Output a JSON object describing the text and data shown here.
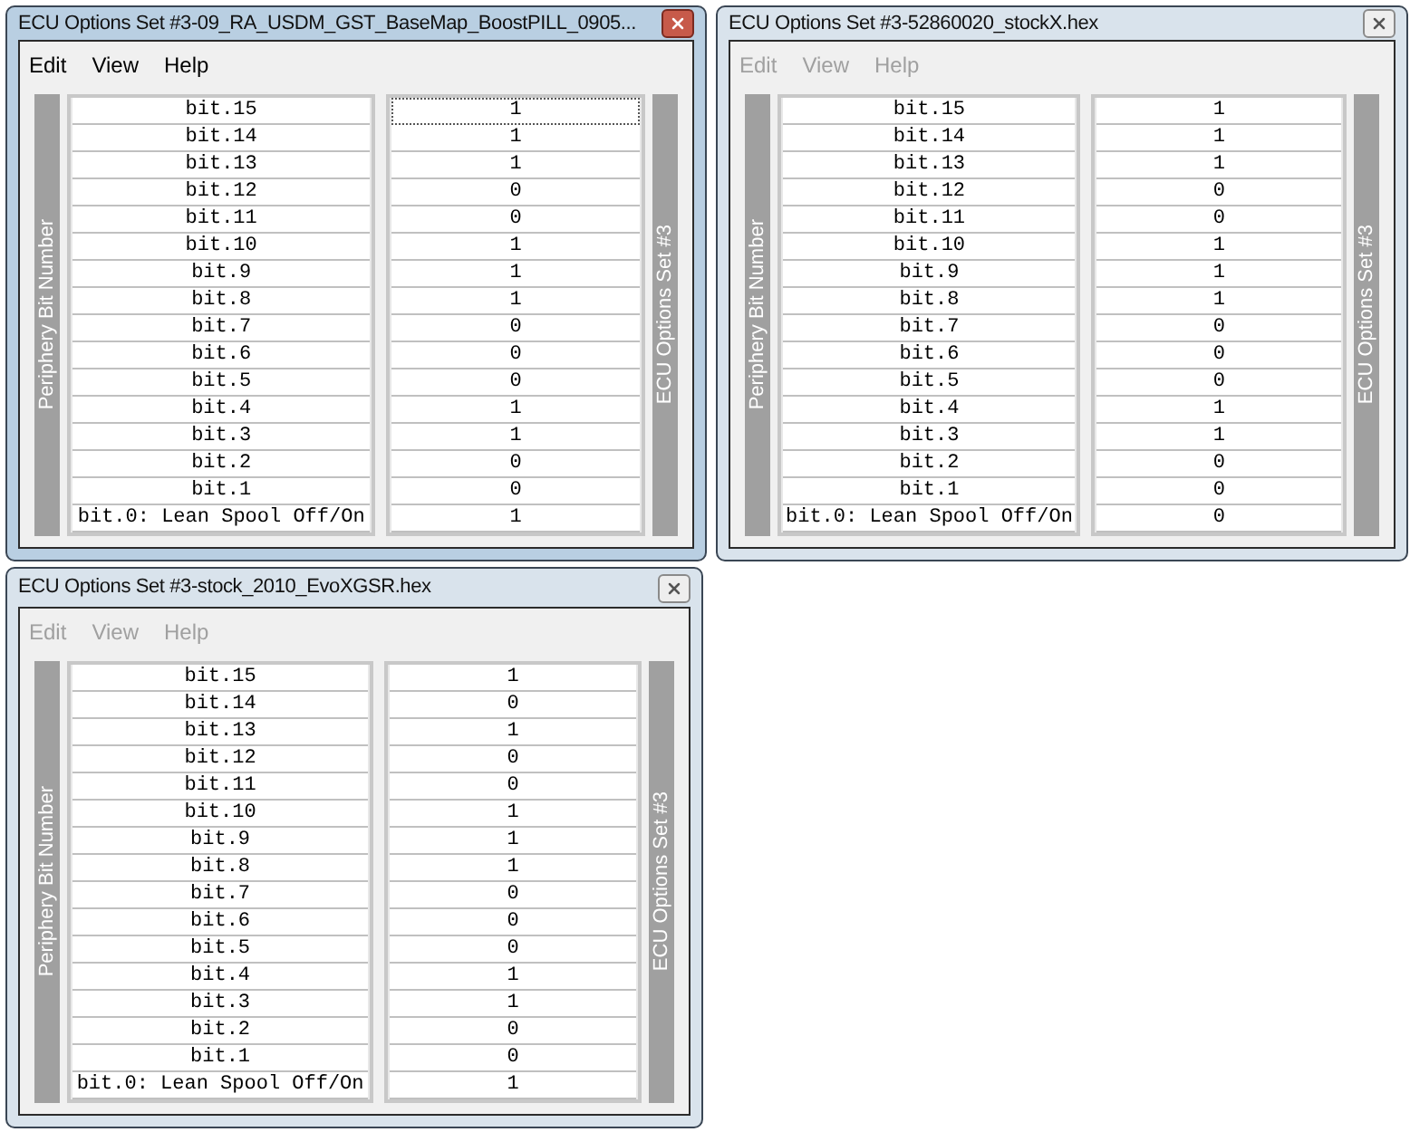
{
  "windows": [
    {
      "title": "ECU Options Set #3-09_RA_USDM_GST_BaseMap_BoostPILL_0905...",
      "active": true,
      "menu": [
        "Edit",
        "View",
        "Help"
      ],
      "left_axis": "Periphery Bit Number",
      "right_axis": "ECU Options Set #3",
      "rows": [
        {
          "label": "bit.15",
          "value": "1",
          "focused": true
        },
        {
          "label": "bit.14",
          "value": "1",
          "focused": false
        },
        {
          "label": "bit.13",
          "value": "1",
          "focused": false
        },
        {
          "label": "bit.12",
          "value": "0",
          "focused": false
        },
        {
          "label": "bit.11",
          "value": "0",
          "focused": false
        },
        {
          "label": "bit.10",
          "value": "1",
          "focused": false
        },
        {
          "label": "bit.9",
          "value": "1",
          "focused": false
        },
        {
          "label": "bit.8",
          "value": "1",
          "focused": false
        },
        {
          "label": "bit.7",
          "value": "0",
          "focused": false
        },
        {
          "label": "bit.6",
          "value": "0",
          "focused": false
        },
        {
          "label": "bit.5",
          "value": "0",
          "focused": false
        },
        {
          "label": "bit.4",
          "value": "1",
          "focused": false
        },
        {
          "label": "bit.3",
          "value": "1",
          "focused": false
        },
        {
          "label": "bit.2",
          "value": "0",
          "focused": false
        },
        {
          "label": "bit.1",
          "value": "0",
          "focused": false
        },
        {
          "label": "bit.0: Lean Spool Off/On",
          "value": "1",
          "focused": false
        }
      ]
    },
    {
      "title": "ECU Options Set #3-52860020_stockX.hex",
      "active": false,
      "menu": [
        "Edit",
        "View",
        "Help"
      ],
      "left_axis": "Periphery Bit Number",
      "right_axis": "ECU Options Set #3",
      "rows": [
        {
          "label": "bit.15",
          "value": "1",
          "focused": false
        },
        {
          "label": "bit.14",
          "value": "1",
          "focused": false
        },
        {
          "label": "bit.13",
          "value": "1",
          "focused": false
        },
        {
          "label": "bit.12",
          "value": "0",
          "focused": false
        },
        {
          "label": "bit.11",
          "value": "0",
          "focused": false
        },
        {
          "label": "bit.10",
          "value": "1",
          "focused": false
        },
        {
          "label": "bit.9",
          "value": "1",
          "focused": false
        },
        {
          "label": "bit.8",
          "value": "1",
          "focused": false
        },
        {
          "label": "bit.7",
          "value": "0",
          "focused": false
        },
        {
          "label": "bit.6",
          "value": "0",
          "focused": false
        },
        {
          "label": "bit.5",
          "value": "0",
          "focused": false
        },
        {
          "label": "bit.4",
          "value": "1",
          "focused": false
        },
        {
          "label": "bit.3",
          "value": "1",
          "focused": false
        },
        {
          "label": "bit.2",
          "value": "0",
          "focused": false
        },
        {
          "label": "bit.1",
          "value": "0",
          "focused": false
        },
        {
          "label": "bit.0: Lean Spool Off/On",
          "value": "0",
          "focused": false
        }
      ]
    },
    {
      "title": "ECU Options Set #3-stock_2010_EvoXGSR.hex",
      "active": false,
      "menu": [
        "Edit",
        "View",
        "Help"
      ],
      "left_axis": "Periphery Bit Number",
      "right_axis": "ECU Options Set #3",
      "rows": [
        {
          "label": "bit.15",
          "value": "1",
          "focused": false
        },
        {
          "label": "bit.14",
          "value": "0",
          "focused": false
        },
        {
          "label": "bit.13",
          "value": "1",
          "focused": false
        },
        {
          "label": "bit.12",
          "value": "0",
          "focused": false
        },
        {
          "label": "bit.11",
          "value": "0",
          "focused": false
        },
        {
          "label": "bit.10",
          "value": "1",
          "focused": false
        },
        {
          "label": "bit.9",
          "value": "1",
          "focused": false
        },
        {
          "label": "bit.8",
          "value": "1",
          "focused": false
        },
        {
          "label": "bit.7",
          "value": "0",
          "focused": false
        },
        {
          "label": "bit.6",
          "value": "0",
          "focused": false
        },
        {
          "label": "bit.5",
          "value": "0",
          "focused": false
        },
        {
          "label": "bit.4",
          "value": "1",
          "focused": false
        },
        {
          "label": "bit.3",
          "value": "1",
          "focused": false
        },
        {
          "label": "bit.2",
          "value": "0",
          "focused": false
        },
        {
          "label": "bit.1",
          "value": "0",
          "focused": false
        },
        {
          "label": "bit.0: Lean Spool Off/On",
          "value": "1",
          "focused": false
        }
      ]
    }
  ]
}
